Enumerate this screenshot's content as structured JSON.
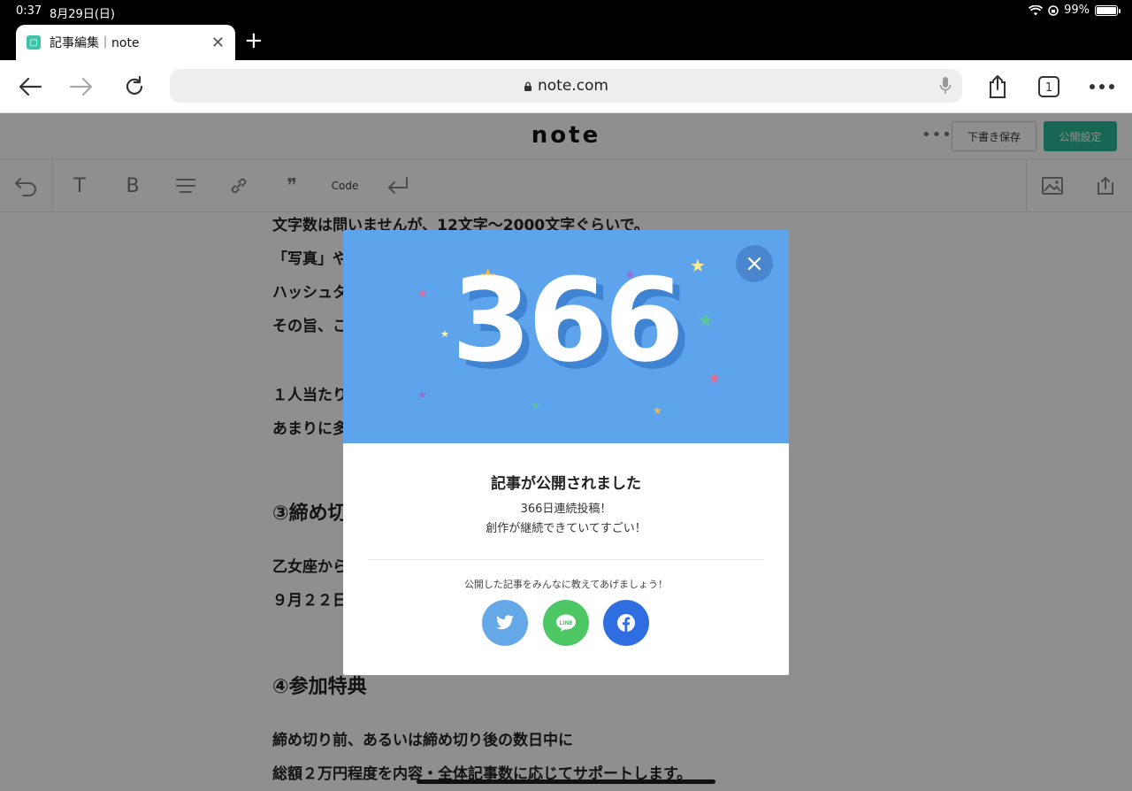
{
  "status_bar": {
    "time": "0:37",
    "date": "8月29日(日)",
    "battery": "99%"
  },
  "browser": {
    "tab_title": "記事編集｜note",
    "url": "note.com"
  },
  "editor": {
    "logo": "note",
    "more": "•••",
    "draft_button": "下書き保存",
    "publish_button": "公開設定",
    "toolbar_code": "Code",
    "lines": [
      "文字数は問いませんが、12文字〜2000文字ぐらいで。",
      "「写真」や",
      "ハッシュタ",
      "その旨、こ",
      "１人当たり",
      "あまりに多",
      "乙女座から",
      "９月２２日",
      "締め切り前、あるいは締め切り後の数日中に",
      "総額２万円程度を内容・全体記事数に応じてサポートします。"
    ],
    "headings": [
      "③締め切",
      "④参加特典"
    ]
  },
  "modal": {
    "number": "366",
    "title": "記事が公開されました",
    "message_line1": "366日連続投稿！",
    "message_line2": "創作が継続できていてすごい！",
    "share_text": "公開した記事をみんなに教えてあげましょう！",
    "line_label": "LINE"
  },
  "colors": {
    "hero_blue": "#5ea4ec",
    "note_green": "#2cb696",
    "twitter": "#55acee",
    "line": "#06c755",
    "facebook": "#1877f2"
  }
}
